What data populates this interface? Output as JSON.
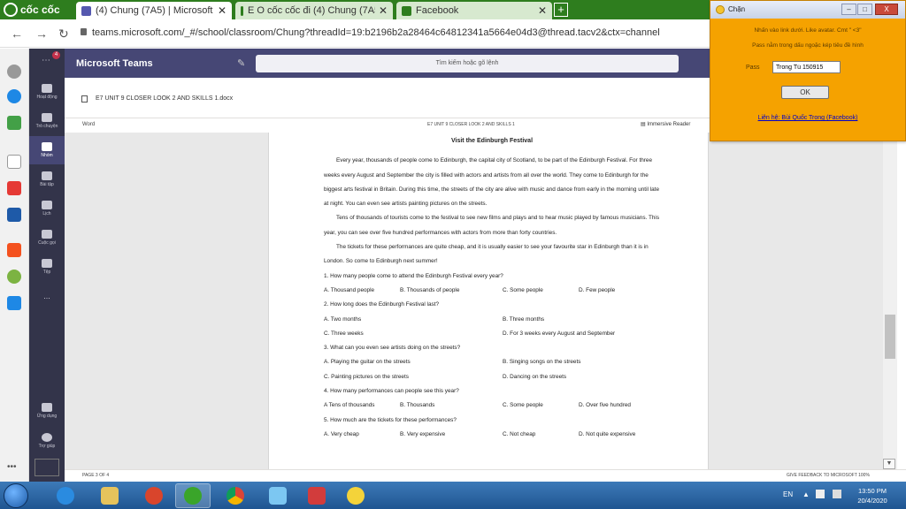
{
  "browser": {
    "brand": "cốc cốc",
    "tabs": [
      {
        "label": "(4) Chung (7A5) | Microsoft Te",
        "icon_color": "#5558af"
      },
      {
        "label": "E O cốc cốc đi (4) Chung (7A5",
        "icon_color": "#2e7d1e"
      },
      {
        "label": "Facebook",
        "icon_color": "#2e7d1e"
      }
    ],
    "new_tab": "+",
    "url": "teams.microsoft.com/_#/school/classroom/Chung?threadId=19:b2196b2a28464c64812341a5664e04d3@thread.tacv2&ctx=channel"
  },
  "teams": {
    "app_name": "Microsoft Teams",
    "search_placeholder": "Tìm kiếm hoặc gõ lệnh",
    "activity_badge": "4",
    "rail": [
      {
        "label": "Hoạt động"
      },
      {
        "label": "Trò chuyện"
      },
      {
        "label": "Nhóm"
      },
      {
        "label": "Bài tập"
      },
      {
        "label": "Lịch"
      },
      {
        "label": "Cuộc gọi"
      },
      {
        "label": "Tệp"
      },
      {
        "label": "..."
      },
      {
        "label": "Ứng dụng"
      },
      {
        "label": "Trợ giúp"
      }
    ],
    "document_name": "E7 UNIT 9 CLOSER LOOK 2 AND SKILLS 1.docx"
  },
  "word": {
    "app_label": "Word",
    "doc_title": "E7 UNIT 9 CLOSER LOOK 2 AND SKILLS 1",
    "immersive_reader": "Immersive Reader",
    "page_info": "PAGE 3 OF 4",
    "feedback": "GIVE FEEDBACK TO MICROSOFT   100%"
  },
  "document": {
    "title": "Visit the Edinburgh Festival",
    "paragraphs": [
      "Every year, thousands of people come to Edinburgh, the capital city of Scotland, to be part of the Edinburgh Festival. For three weeks every August and September the city is filled with actors and artists from all over the world. They come to Edinburgh for the biggest arts festival in Britain. During this time, the streets of the city are alive with music and dance from early in the morning until late at night. You can even see artists painting pictures on the streets.",
      "Tens of thousands of tourists come to the festival to see new films and plays and to hear music played by famous musicians. This year, you can see over five hundred performances with actors from more than forty countries.",
      "The tickets for these performances are quite cheap, and it is usually easier to see your favourite star in Edinburgh than it is in London. So come to Edinburgh next summer!"
    ],
    "questions": [
      {
        "q": "1. How many people come to attend the Edinburgh Festival every year?",
        "options": [
          "A. Thousand people",
          "B. Thousands of people",
          "C. Some people",
          "D. Few people"
        ],
        "layout": "row"
      },
      {
        "q": "2. How long does the Edinburgh Festival last?",
        "options": [
          "A. Two months",
          "B. Three months",
          "C. Three weeks",
          "D. For 3 weeks every August and September"
        ],
        "layout": "grid"
      },
      {
        "q": "3. What can you even see artists doing on the streets?",
        "options": [
          "A. Playing the guitar on the streets",
          "B. Singing songs on the streets",
          "C. Painting pictures on the streets",
          "D. Dancing on the streets"
        ],
        "layout": "grid"
      },
      {
        "q": "4. How many performances can people see this year?",
        "options": [
          "A Tens of thousands",
          "B. Thousands",
          "C. Some people",
          "D. Over five hundred"
        ],
        "layout": "row"
      },
      {
        "q": "5. How much are the tickets for these performances?",
        "options": [
          "A. Very cheap",
          "B. Very expensive",
          "C. Not cheap",
          "D. Not quite expensive"
        ],
        "layout": "row"
      }
    ]
  },
  "popup": {
    "title": "Chặn",
    "minimize": "–",
    "maximize": "□",
    "close": "X",
    "message1": "Nhấn vào link dưới. Like avatar. Cmt \" <3\"",
    "message2": "Pass nằm trong dấu ngoặc kép tiêu đề hình",
    "pass_label": "Pass",
    "pass_value": "Trong Tú 150915",
    "ok_label": "OK",
    "link_text": "Liên hệ: Bùi Quốc Trong (Facebook)"
  },
  "taskbar": {
    "lang": "EN",
    "time": "13:50 PM",
    "date": "20/4/2020"
  }
}
